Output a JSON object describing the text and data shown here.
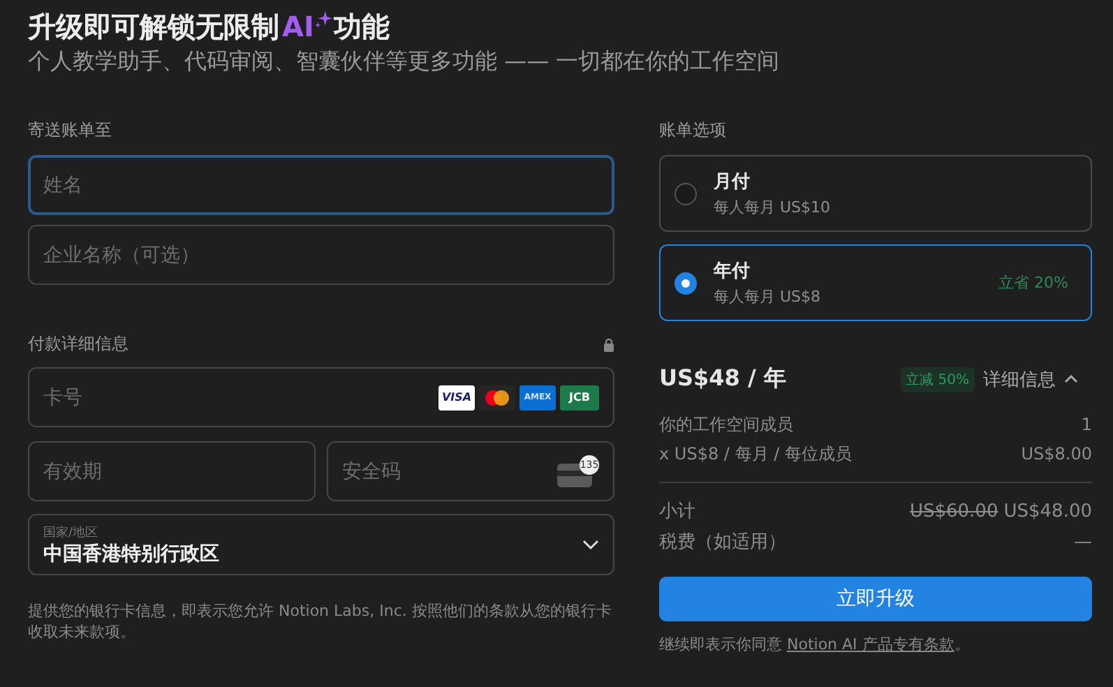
{
  "header": {
    "title_before": "升级即可解锁无限制 ",
    "title_ai": "AI",
    "title_after": "功能",
    "subtitle": "个人教学助手、代码审阅、智囊伙伴等更多功能 —— 一切都在你的工作空间"
  },
  "billing_address": {
    "label": "寄送账单至",
    "fields": [
      {
        "placeholder": "姓名",
        "focused": true
      },
      {
        "placeholder": "企业名称（可选）",
        "focused": false
      }
    ]
  },
  "payment": {
    "label": "付款详细信息",
    "card_number": {
      "placeholder": "卡号"
    },
    "card_logos": [
      {
        "kind": "visa",
        "text": "VISA"
      },
      {
        "kind": "mastercard"
      },
      {
        "kind": "amex",
        "text": "AMEX"
      },
      {
        "kind": "jcb",
        "text": "JCB"
      }
    ],
    "expiry": {
      "placeholder": "有效期"
    },
    "cvc": {
      "placeholder": "安全码",
      "icon_text": "135"
    },
    "country": {
      "label": "国家/地区",
      "value": "中国香港特别行政区"
    },
    "note": "提供您的银行卡信息，即表示您允许 Notion Labs, Inc. 按照他们的条款从您的银行卡收取未来款项。"
  },
  "billing_options": {
    "label": "账单选项",
    "options": [
      {
        "title": "月付",
        "price": "每人每月 US$10",
        "selected": false
      },
      {
        "title": "年付",
        "price": "每人每月 US$8",
        "badge": "立省 20%",
        "selected": true
      }
    ]
  },
  "summary": {
    "total": "US$48 / 年",
    "discount": "立减 50%",
    "details": "详细信息",
    "rows": [
      {
        "label": "你的工作空间成员",
        "value": "1"
      },
      {
        "label": "x US$8 / 每月 / 每位成员",
        "value": "US$8.00"
      }
    ],
    "subtotal": {
      "label": "小计",
      "old": "US$60.00",
      "value": "US$48.00"
    },
    "tax": {
      "label": "税费（如适用）",
      "value": "—"
    },
    "button": "立即升级",
    "terms_before": "继续即表示你同意 ",
    "terms_link": "Notion AI 产品专有条款",
    "terms_after": "。"
  }
}
